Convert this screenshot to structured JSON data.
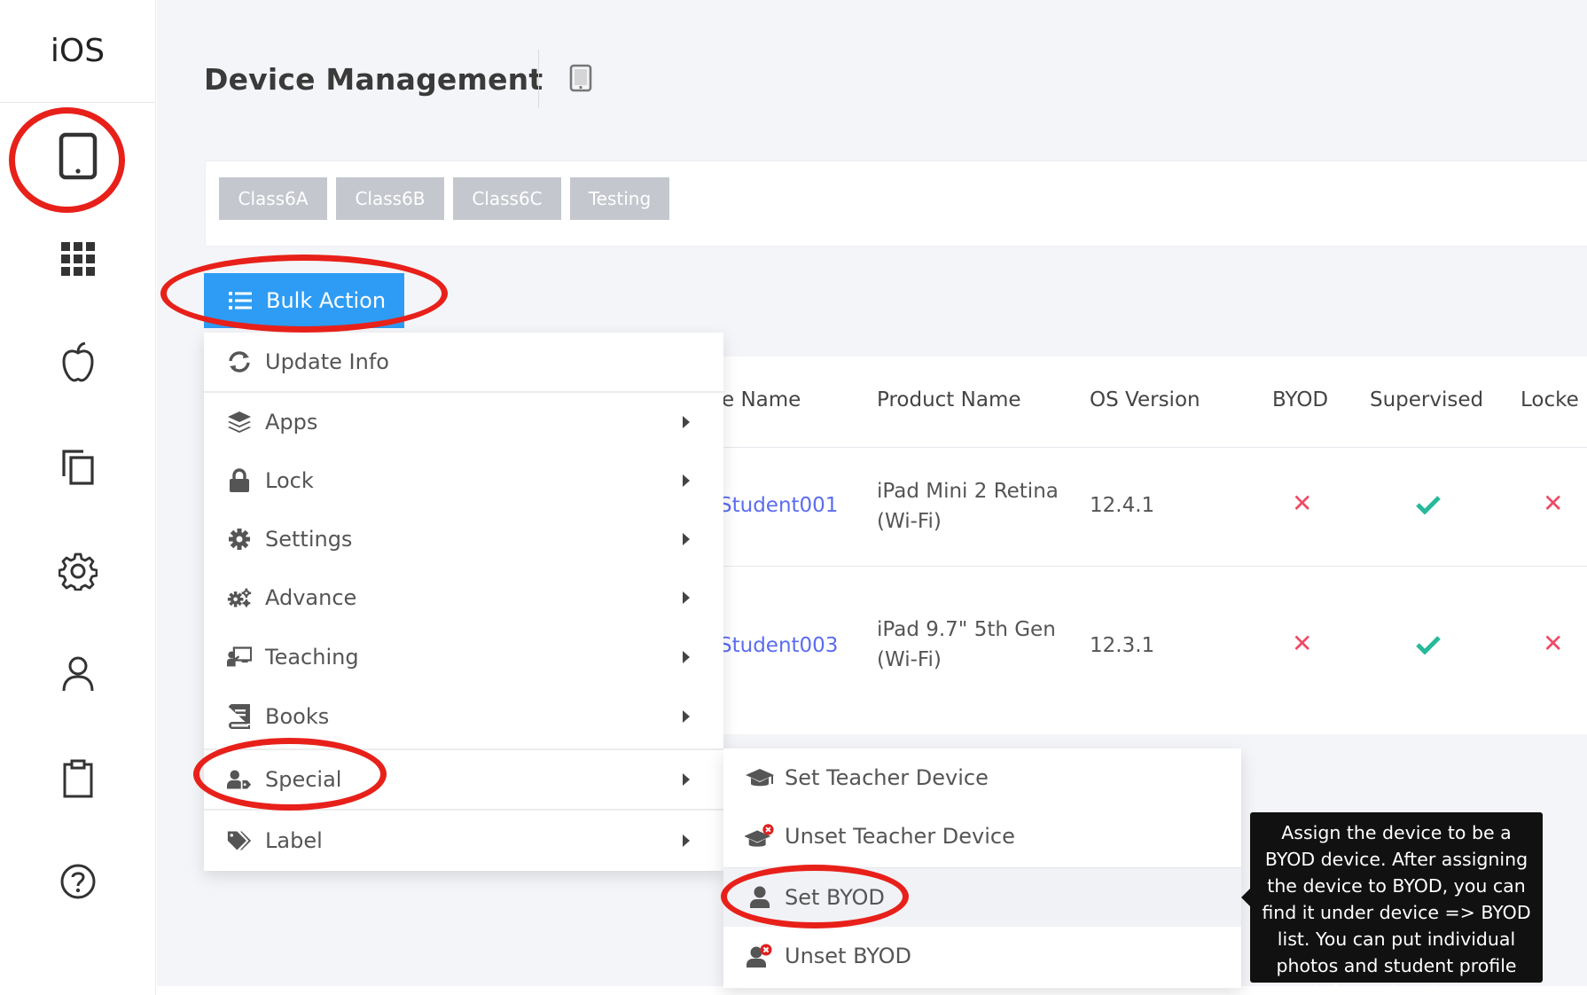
{
  "sidebar": {
    "brand": "iOS",
    "items": [
      {
        "icon": "tablet-icon"
      },
      {
        "icon": "grid-icon"
      },
      {
        "icon": "apple-icon"
      },
      {
        "icon": "copy-icon"
      },
      {
        "icon": "gear-icon"
      },
      {
        "icon": "user-icon"
      },
      {
        "icon": "clipboard-icon"
      },
      {
        "icon": "help-icon"
      }
    ]
  },
  "header": {
    "title": "Device Management"
  },
  "classes": [
    "Class6A",
    "Class6B",
    "Class6C",
    "Testing"
  ],
  "bulk_action": {
    "label": "Bulk Action"
  },
  "table": {
    "headers": [
      "e Name",
      "Product Name",
      "OS Version",
      "BYOD",
      "Supervised",
      "Locke"
    ],
    "rows": [
      {
        "name": "Student001",
        "product_line1": "iPad Mini 2 Retina",
        "product_line2": "(Wi-Fi)",
        "os": "12.4.1",
        "byod": false,
        "supervised": true,
        "locked": false
      },
      {
        "name": "Student003",
        "product_line1": "iPad 9.7\" 5th Gen",
        "product_line2": "(Wi-Fi)",
        "os": "12.3.1",
        "byod": false,
        "supervised": true,
        "locked": false
      }
    ]
  },
  "menu": {
    "items": [
      "Update Info",
      "Apps",
      "Lock",
      "Settings",
      "Advance",
      "Teaching",
      "Books",
      "Special",
      "Label"
    ]
  },
  "submenu": {
    "items": [
      "Set Teacher Device",
      "Unset Teacher Device",
      "Set BYOD",
      "Unset BYOD"
    ]
  },
  "tooltip": {
    "text": "Assign the device to be a BYOD device. After assigning the device to BYOD, you can find it under device => BYOD list. You can put individual photos and student profile information there."
  },
  "colors": {
    "accent": "#2e9cf4",
    "annotation": "#e8201a",
    "cross": "#ef4b66",
    "check": "#26b99a",
    "link": "#5b6cf0"
  }
}
